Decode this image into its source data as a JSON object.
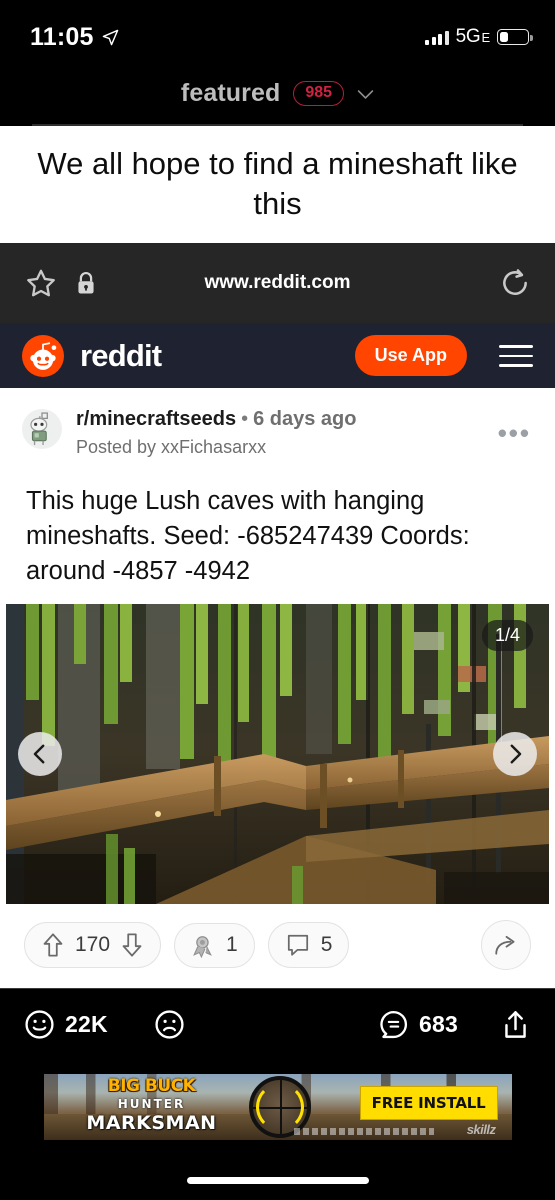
{
  "status_bar": {
    "time": "11:05",
    "location_icon": "location-arrow-icon",
    "signal_icon": "cellular-bars-icon",
    "network": "5G",
    "network_suffix": "E",
    "battery_icon": "battery-icon"
  },
  "app_header": {
    "title": "featured",
    "badge_count": "985",
    "chevron_icon": "chevron-down-icon",
    "badge_color": "#cf2343"
  },
  "meme": {
    "caption": "We all hope to find a mineshaft like this"
  },
  "browser_bar": {
    "bookmark_icon": "star-icon",
    "lock_icon": "lock-icon",
    "url": "www.reddit.com",
    "reload_icon": "reload-icon"
  },
  "reddit_nav": {
    "logo_icon": "reddit-snoo-icon",
    "wordmark": "reddit",
    "use_app_label": "Use App",
    "menu_icon": "hamburger-menu-icon",
    "accent_color": "#ff4500",
    "background_color": "#1f2230"
  },
  "post": {
    "avatar_icon": "subreddit-avatar-icon",
    "subreddit": "r/minecraftseeds",
    "separator": "•",
    "timestamp": "6 days ago",
    "author_line": "Posted by xxFichasarxx",
    "more_icon": "more-options-icon",
    "more_label": "•••",
    "title": "This huge Lush caves with hanging mineshafts. Seed: -685247439 Coords: around -4857 -4942",
    "gallery": {
      "counter": "1/4",
      "prev_icon": "chevron-left-icon",
      "next_icon": "chevron-right-icon",
      "alt": "Minecraft lush cave with hanging vines and wooden mineshaft bridges"
    },
    "actions": {
      "upvote_icon": "upvote-arrow-icon",
      "score": "170",
      "downvote_icon": "downvote-arrow-icon",
      "award_icon": "award-icon",
      "award_count": "1",
      "comment_icon": "comment-bubble-icon",
      "comment_count": "5",
      "share_icon": "share-arrow-icon"
    }
  },
  "bottom_bar": {
    "upvote_icon": "smiley-face-icon",
    "upvote_count": "22K",
    "downvote_icon": "frowny-face-icon",
    "comment_icon": "comment-icon",
    "comment_count": "683",
    "share_icon": "share-upload-icon"
  },
  "ad": {
    "title": "BIG BUCK",
    "subtitle": "HUNTER",
    "tagline": "MARKSMAN",
    "cta": "FREE INSTALL",
    "brand": "skillz",
    "scope_icon": "rifle-scope-icon"
  }
}
